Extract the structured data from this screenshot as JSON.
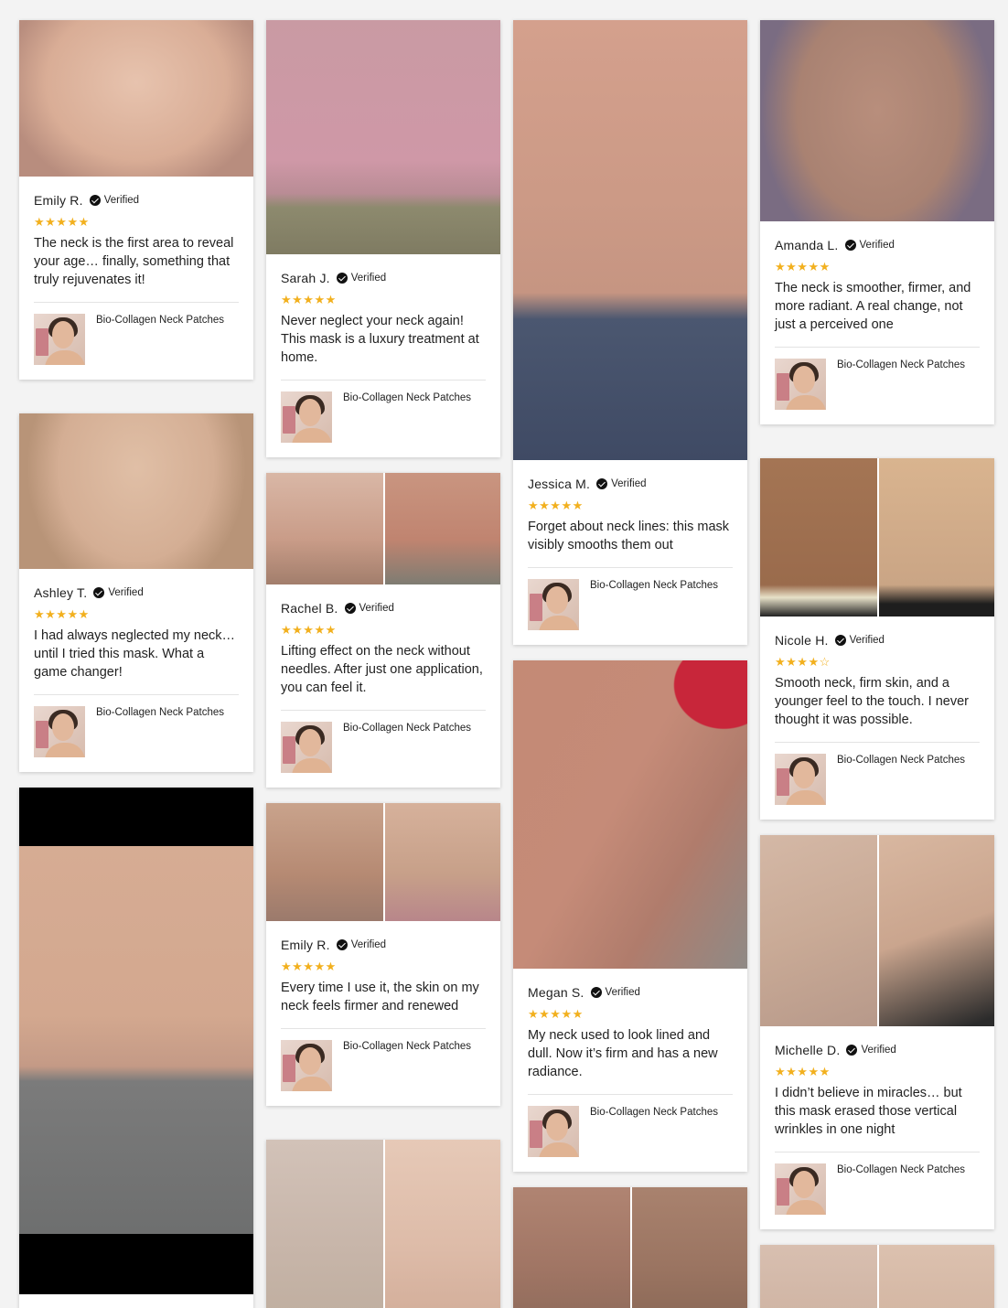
{
  "verified_label": "Verified",
  "product_name": "Bio-Collagen Neck Patches",
  "colors": {
    "star": "#f2b01e",
    "card": "#ffffff",
    "page": "#f3f3f3"
  },
  "reviews": [
    {
      "name": "Emily R.",
      "rating": 5,
      "stars": "★★★★★",
      "text": "The neck is the first area to reveal your age… finally, something that truly rejuvenates it!"
    },
    {
      "name": "Ashley T.",
      "rating": 5,
      "stars": "★★★★★",
      "text": "I had always neglected my neck… until I tried this mask. What a game changer!"
    },
    {
      "name": "Sarah J.",
      "rating": 5,
      "stars": "★★★★★",
      "text": "Never neglect your neck again! This mask is a luxury treatment at home."
    },
    {
      "name": "Rachel B.",
      "rating": 5,
      "stars": "★★★★★",
      "text": "Lifting effect on the neck without needles. After just one application, you can feel it."
    },
    {
      "name": "Emily R.",
      "rating": 5,
      "stars": "★★★★★",
      "text": "Every time I use it, the skin on my neck feels firmer and renewed"
    },
    {
      "name": "Jessica M.",
      "rating": 5,
      "stars": "★★★★★",
      "text": "Forget about neck lines: this mask visibly smooths them out"
    },
    {
      "name": "Megan S.",
      "rating": 5,
      "stars": "★★★★★",
      "text": "My neck used to look lined and dull. Now it’s firm and has a new radiance."
    },
    {
      "name": "Amanda L.",
      "rating": 5,
      "stars": "★★★★★",
      "text": "The neck is smoother, firmer, and more radiant. A real change, not just a perceived one"
    },
    {
      "name": "Nicole H.",
      "rating": 4,
      "stars": "★★★★☆",
      "text": "Smooth neck, firm skin, and a younger feel to the touch. I never thought it was possible."
    },
    {
      "name": "Michelle D.",
      "rating": 5,
      "stars": "★★★★★",
      "text": "I didn’t believe in miracles… but this mask erased those vertical wrinkles in one night"
    }
  ]
}
